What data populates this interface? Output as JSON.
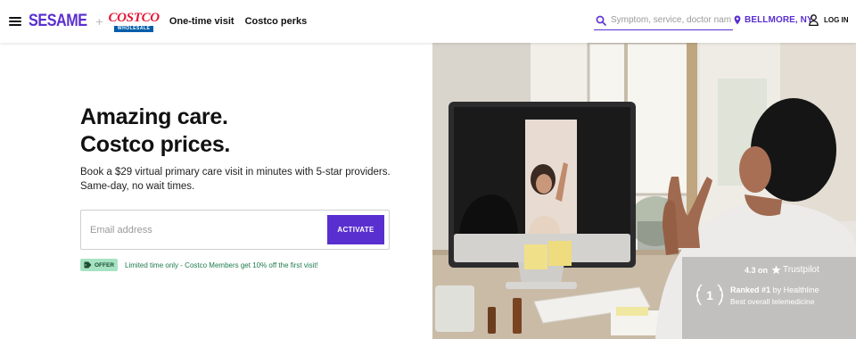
{
  "header": {
    "brand": "SESAME",
    "plus": "+",
    "partner_logo": {
      "word": "COSTCO",
      "sub": "WHOLESALE"
    },
    "nav": [
      "One-time visit",
      "Costco perks"
    ],
    "search": {
      "placeholder": "Symptom, service, doctor name"
    },
    "location": "BELLMORE, NY",
    "login_label": "LOG IN"
  },
  "hero": {
    "title_line1": "Amazing care.",
    "title_line2": "Costco prices.",
    "subtitle": "Book a $29 virtual primary care visit in minutes with 5-star providers. Same-day, no wait times.",
    "email_placeholder": "Email address",
    "activate_label": "ACTIVATE",
    "offer_badge": "OFFER",
    "offer_text": "Limited time only - Costco Members get 10% off the first visit!"
  },
  "photo_overlay": {
    "rating_value": "4.3 on",
    "rating_source": "Trustpilot",
    "award_rank_prefix": "Ranked",
    "award_rank": "#1",
    "award_rank_suffix": "by Healthline",
    "award_subtitle": "Best overall telemedicine",
    "award_badge_number": "1"
  },
  "colors": {
    "brand_purple": "#5a2fd0",
    "costco_red": "#e31837",
    "costco_blue": "#005daa",
    "offer_green": "#a6e3c3"
  },
  "icons": [
    "menu-icon",
    "search-icon",
    "pin-icon",
    "user-icon",
    "tag-icon",
    "star-icon",
    "laurel-icon"
  ]
}
